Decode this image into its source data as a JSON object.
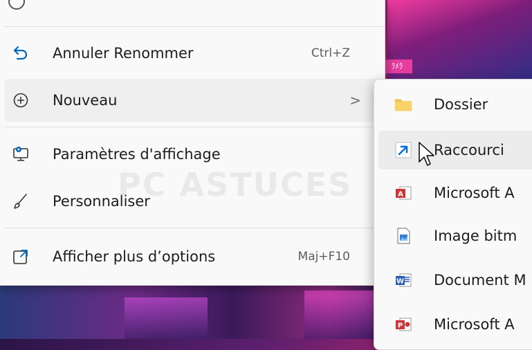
{
  "menu": {
    "items": [
      {
        "label": "Annuler Renommer",
        "shortcut": "Ctrl+Z",
        "icon": "undo-icon"
      },
      {
        "label": "Nouveau",
        "chevron": ">",
        "icon": "plus-circle-icon"
      },
      {
        "label": "Paramètres d'affichage",
        "icon": "display-settings-icon"
      },
      {
        "label": "Personnaliser",
        "icon": "paintbrush-icon"
      },
      {
        "label": "Afficher plus d’options",
        "shortcut": "Maj+F10",
        "icon": "open-external-icon"
      }
    ]
  },
  "submenu": {
    "items": [
      {
        "label": "Dossier",
        "icon": "folder-icon"
      },
      {
        "label": "Raccourci",
        "icon": "shortcut-arrow-icon"
      },
      {
        "label": "Microsoft A",
        "icon": "access-icon"
      },
      {
        "label": "Image bitm",
        "icon": "bitmap-icon"
      },
      {
        "label": "Document M",
        "icon": "word-icon"
      },
      {
        "label": "Microsoft A",
        "icon": "powerpoint-icon"
      }
    ]
  },
  "wallpaper": {
    "sign_text": "ﾗﾒﾗ"
  },
  "watermark": {
    "text": "PC ASTUCES"
  },
  "colors": {
    "accent": "#0067c0",
    "folder": "#f3c14b",
    "access_red": "#c8383a",
    "word_blue": "#2b5fb4"
  }
}
